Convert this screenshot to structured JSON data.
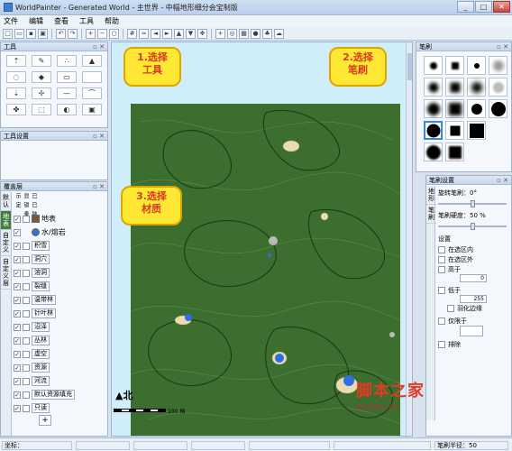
{
  "window": {
    "title": "WorldPainter - Generated World - 主世界 - 中幅地形细分会宝制版",
    "buttons": [
      "_",
      "□",
      "✕"
    ]
  },
  "menu": [
    "文件",
    "编辑",
    "查看",
    "工具",
    "帮助"
  ],
  "panels": {
    "tools": {
      "title": "工具"
    },
    "tool_settings": {
      "title": "工具设置"
    },
    "layers": {
      "title": "覆盖层",
      "columns": [
        "已显示",
        "已锁定",
        "独奏"
      ],
      "side_tabs": [
        "默认",
        "地表",
        "自定义",
        "自定义层"
      ],
      "items": [
        {
          "label": "地表",
          "checked": true,
          "button": false
        },
        {
          "label": "水/熔岩",
          "checked": true,
          "button": false
        },
        {
          "label": "积雪",
          "checked": true,
          "button": true
        },
        {
          "label": "洞穴",
          "checked": true,
          "button": true
        },
        {
          "label": "溶洞",
          "checked": true,
          "button": true
        },
        {
          "label": "裂缝",
          "checked": true,
          "button": true
        },
        {
          "label": "温带林",
          "checked": true,
          "button": true
        },
        {
          "label": "针叶林",
          "checked": true,
          "button": true
        },
        {
          "label": "沼泽",
          "checked": true,
          "button": true
        },
        {
          "label": "丛林",
          "checked": true,
          "button": true
        },
        {
          "label": "虚空",
          "checked": true,
          "button": true
        },
        {
          "label": "资源",
          "checked": true,
          "button": true
        },
        {
          "label": "河流",
          "checked": true,
          "button": true
        },
        {
          "label": "默认资源填充",
          "checked": true,
          "button": true
        },
        {
          "label": "只读",
          "checked": true,
          "button": true
        }
      ],
      "add_label": "+"
    },
    "brushes": {
      "title": "笔刷"
    },
    "brush_settings": {
      "title": "笔刷设置",
      "rotation_label": "旋转笔刷：0°",
      "rotation_value": 0.5,
      "hardness_label": "笔刷硬度：50 %",
      "hardness_value": 0.5,
      "settings_label": "设置",
      "options": [
        "在选区内",
        "在选区外",
        "高于",
        "低于",
        "仅限于",
        "排除"
      ],
      "spin1": "0",
      "spin2": "255",
      "smooth_label": "羽化边缘",
      "side_tabs": [
        "地形",
        "笔刷"
      ]
    }
  },
  "map": {
    "north_label": "北",
    "scale_label": "100 格"
  },
  "callouts": [
    {
      "text": "1.选择\n工具"
    },
    {
      "text": "2.选择\n笔刷"
    },
    {
      "text": "3.选择\n材质"
    }
  ],
  "status": {
    "coords": "坐标：",
    "brush_radius": "笔刷半径：50"
  },
  "watermark": {
    "main": "脚本之家",
    "sub": "www.jb51.net"
  },
  "colors": {
    "terrain": "#3b6e2f",
    "sky": "#cfeef9",
    "callout_fill": "#ffe833",
    "callout_text": "#d73a21"
  }
}
